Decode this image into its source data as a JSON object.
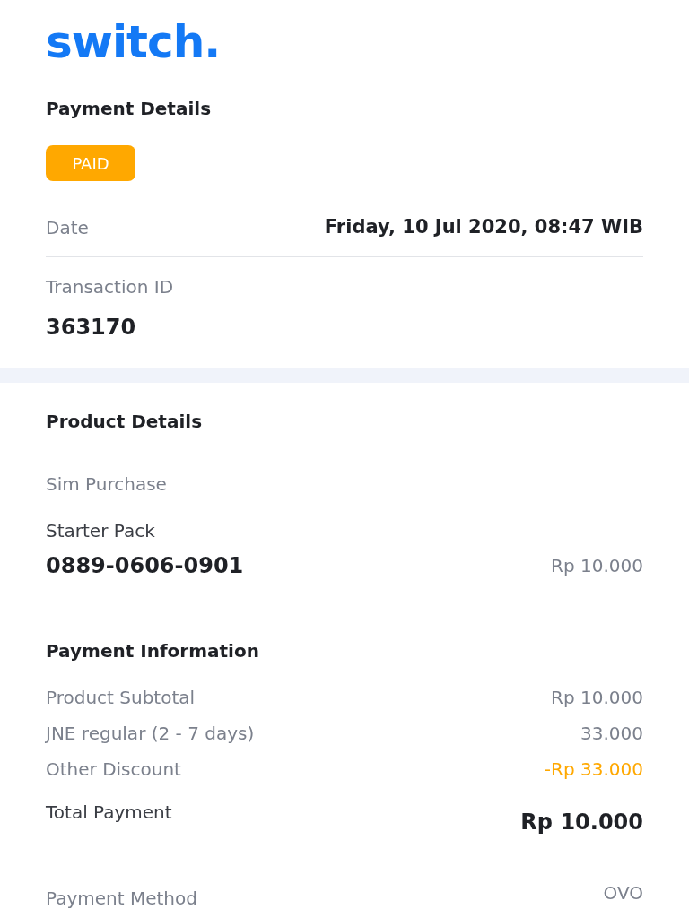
{
  "logo": "switch.",
  "payment_details": {
    "title": "Payment Details",
    "status": "PAID",
    "date_label": "Date",
    "date_value": "Friday, 10 Jul 2020, 08:47 WIB",
    "transaction_label": "Transaction ID",
    "transaction_id": "363170"
  },
  "product_details": {
    "title": "Product Details",
    "category": "Sim Purchase",
    "product": "Starter Pack",
    "number": "0889-0606-0901",
    "price": "Rp 10.000"
  },
  "payment_information": {
    "title": "Payment Information",
    "rows": [
      {
        "label": "Product Subtotal",
        "value": "Rp 10.000",
        "kind": "normal"
      },
      {
        "label": "JNE regular (2 - 7 days)",
        "value": "33.000",
        "kind": "normal"
      },
      {
        "label": "Other Discount",
        "value": "-Rp 33.000",
        "kind": "discount"
      }
    ],
    "total_label": "Total Payment",
    "total_value": "Rp 10.000",
    "method_label": "Payment Method",
    "method_value": "OVO"
  }
}
